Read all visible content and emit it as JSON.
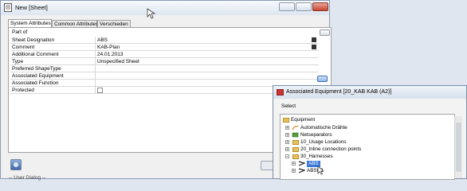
{
  "main": {
    "title": "New [Sheet]",
    "tabs": [
      "System Attributes",
      "Common Attributes",
      "Verschieden"
    ],
    "part_of": "Part of",
    "rows": [
      {
        "label": "Sheet Designation",
        "value": "ABS"
      },
      {
        "label": "Comment",
        "value": "KAB-Plan"
      },
      {
        "label": "Additional Comment",
        "value": "24.01.2013"
      },
      {
        "label": "Type",
        "value": "Unspecified Sheet"
      },
      {
        "label": "Preferred ShapeType",
        "value": ""
      },
      {
        "label": "Associated Equipment",
        "value": ""
      },
      {
        "label": "Associated Function",
        "value": ""
      },
      {
        "label": "Protected",
        "value": ""
      }
    ],
    "user_dialog": "-- User Dialog --"
  },
  "assoc": {
    "title": "Associated Equipment [20_KAB KAB (A2)]",
    "select_label": "Select",
    "tree": [
      {
        "label": "Equipment"
      },
      {
        "label": "Automatische Drähte"
      },
      {
        "label": "Netseparators"
      },
      {
        "label": "10_Usage Locations"
      },
      {
        "label": "20_Inline connection points"
      },
      {
        "label": "30_Harnesses"
      },
      {
        "label": "ABS"
      },
      {
        "label": "ABSFB"
      }
    ]
  },
  "colors": {
    "selection": "#3a78d6",
    "folder": "#e9c15a"
  }
}
